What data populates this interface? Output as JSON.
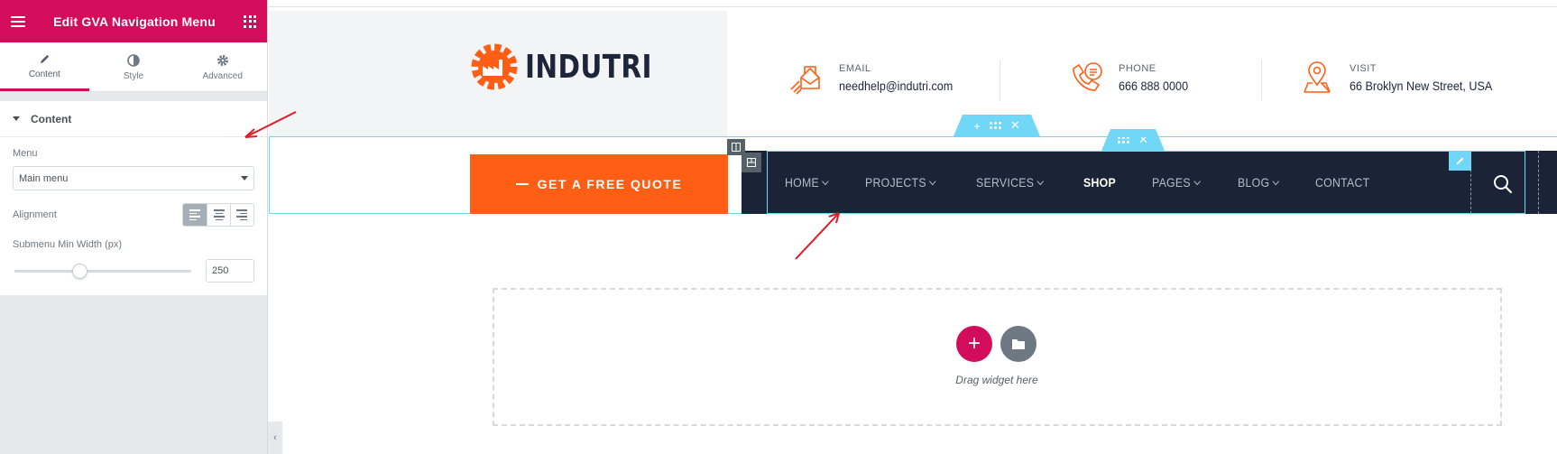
{
  "panel": {
    "title": "Edit GVA Navigation Menu",
    "tabs": [
      {
        "label": "Content",
        "icon": "pencil-icon",
        "active": true
      },
      {
        "label": "Style",
        "icon": "half-circle-icon",
        "active": false
      },
      {
        "label": "Advanced",
        "icon": "gear-icon",
        "active": false
      }
    ],
    "section_title": "Content",
    "menu_label": "Menu",
    "menu_value": "Main menu",
    "alignment_label": "Alignment",
    "alignment_selected": "left",
    "submenu_label": "Submenu Min Width (px)",
    "submenu_value": "250",
    "accent_color": "#d30c5c"
  },
  "site": {
    "logo_text": "INDUTRI",
    "brand_color": "#ff5e14",
    "email": {
      "label": "EMAIL",
      "value": "needhelp@indutri.com"
    },
    "phone": {
      "label": "PHONE",
      "value": "666 888 0000"
    },
    "visit": {
      "label": "VISIT",
      "value": "66 Broklyn New Street, USA"
    },
    "quote_button": "GET A FREE QUOTE",
    "nav": [
      "HOME",
      "PROJECTS",
      "SERVICES",
      "SHOP",
      "PAGES",
      "BLOG",
      "CONTACT"
    ],
    "nav_has_dropdown": [
      true,
      true,
      true,
      false,
      true,
      true,
      false
    ],
    "nav_active": "SHOP",
    "navbar_color": "#1b2437"
  },
  "canvas": {
    "drag_text": "Drag widget here",
    "handle_color": "#71d7f7"
  }
}
